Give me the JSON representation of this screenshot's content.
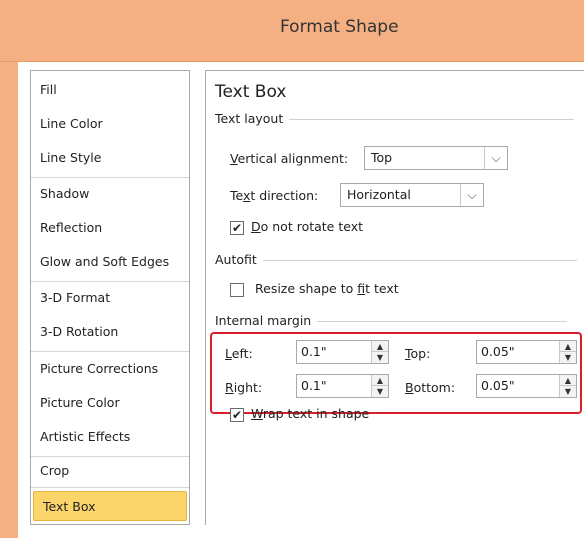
{
  "window": {
    "title": "Format Shape"
  },
  "sidebar": {
    "items": [
      {
        "label": "Fill"
      },
      {
        "label": "Line Color"
      },
      {
        "label": "Line Style"
      },
      {
        "label": "Shadow"
      },
      {
        "label": "Reflection"
      },
      {
        "label": "Glow and Soft Edges"
      },
      {
        "label": "3-D Format"
      },
      {
        "label": "3-D Rotation"
      },
      {
        "label": "Picture Corrections"
      },
      {
        "label": "Picture Color"
      },
      {
        "label": "Artistic Effects"
      },
      {
        "label": "Crop"
      },
      {
        "label": "Text Box"
      }
    ],
    "selected": "Text Box"
  },
  "panel": {
    "heading": "Text Box",
    "text_layout": {
      "section": "Text layout",
      "vertical_alignment_label_u": "V",
      "vertical_alignment_label_rest": "ertical alignment:",
      "vertical_alignment_value": "Top",
      "text_direction_label_a": "Te",
      "text_direction_label_u": "x",
      "text_direction_label_b": "t direction:",
      "text_direction_value": "Horizontal",
      "do_not_rotate_u": "D",
      "do_not_rotate_rest": "o not rotate text",
      "do_not_rotate_checked": true
    },
    "autofit": {
      "section": "Autofit",
      "resize_a": "Resize shape to ",
      "resize_u": "f",
      "resize_b": "it text",
      "resize_checked": false
    },
    "internal_margin": {
      "section": "Internal margin",
      "left_u": "L",
      "left_rest": "eft:",
      "left_value": "0.1\"",
      "top_u": "T",
      "top_rest": "op:",
      "top_value": "0.05\"",
      "right_u": "R",
      "right_rest": "ight:",
      "right_value": "0.1\"",
      "bottom_u": "B",
      "bottom_rest": "ottom:",
      "bottom_value": "0.05\""
    },
    "wrap": {
      "u": "W",
      "rest": "rap text in shape",
      "checked": true
    }
  },
  "icons": {
    "check": "✔",
    "dropdown": "⌵",
    "spin_up": "▲",
    "spin_down": "▼"
  },
  "colors": {
    "title_bar": "#f4b083",
    "selected_item": "#fbd56a",
    "highlight": "#d9202a"
  }
}
